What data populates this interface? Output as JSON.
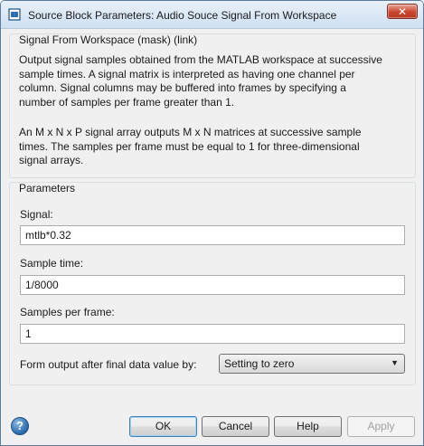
{
  "window": {
    "title": "Source Block Parameters: Audio Souce Signal From Workspace",
    "close_label": "✕"
  },
  "mask": {
    "group_title": "Signal From Workspace (mask) (link)",
    "description_1": "Output signal samples obtained from the MATLAB workspace at successive\nsample times.  A signal matrix is interpreted as having one channel per\ncolumn.  Signal columns may be buffered into frames by specifying a\nnumber of samples per frame greater than 1.",
    "description_2": "An M x N x P signal array outputs M x N matrices at successive sample\ntimes.  The samples per frame must be equal to 1 for three-dimensional\nsignal arrays."
  },
  "parameters": {
    "group_title": "Parameters",
    "signal_label": "Signal:",
    "signal_value": "mtlb*0.32",
    "sample_time_label": "Sample time:",
    "sample_time_value": "1/8000",
    "samples_per_frame_label": "Samples per frame:",
    "samples_per_frame_value": "1",
    "form_output_label": "Form output after final data value by:",
    "form_output_value": "Setting to zero"
  },
  "buttons": {
    "help_icon_glyph": "?",
    "ok": "OK",
    "cancel": "Cancel",
    "help": "Help",
    "apply": "Apply"
  }
}
